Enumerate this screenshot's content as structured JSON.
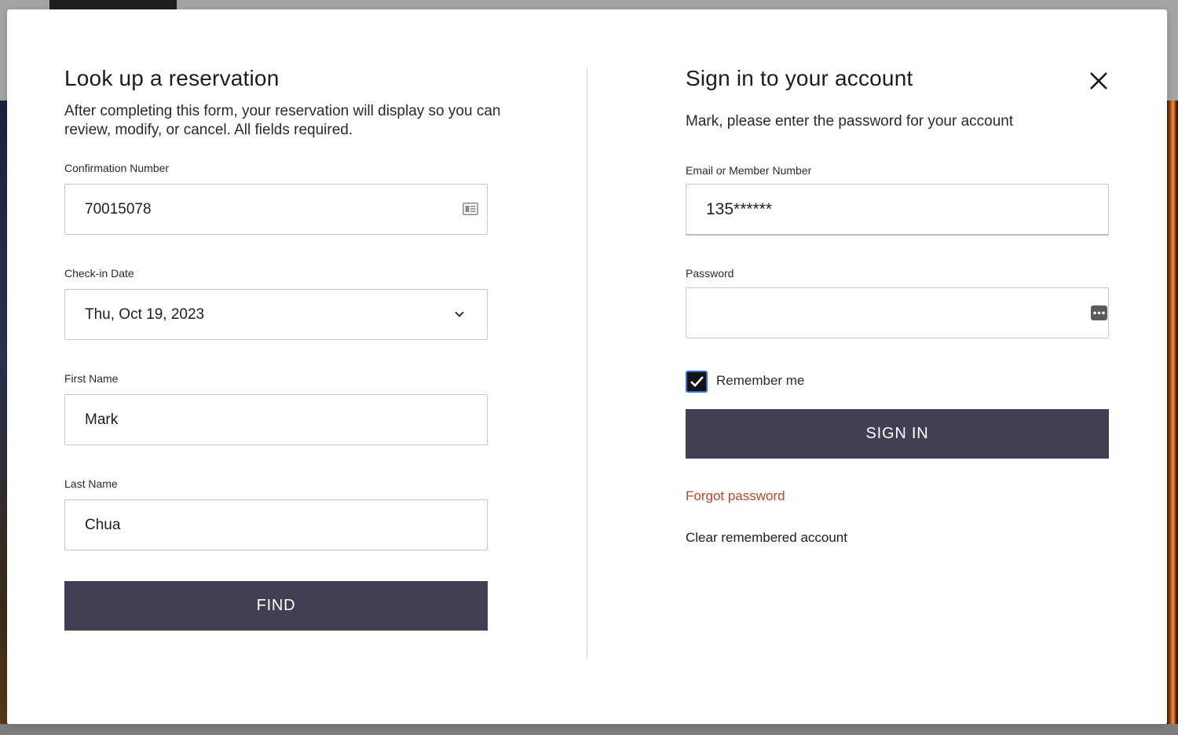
{
  "lookup": {
    "title": "Look up a reservation",
    "intro": "After completing this form, your reservation will display so you can review, modify, or cancel. All fields required.",
    "confirmation": {
      "label": "Confirmation Number",
      "value": "70015078"
    },
    "checkin": {
      "label": "Check-in Date",
      "value": "Thu, Oct 19, 2023"
    },
    "first_name": {
      "label": "First Name",
      "value": "Mark"
    },
    "last_name": {
      "label": "Last Name",
      "value": "Chua"
    },
    "find_label": "FIND"
  },
  "signin": {
    "title": "Sign in to your account",
    "intro": "Mark, please enter the password for your account",
    "email": {
      "label": "Email or Member Number",
      "value": "135******"
    },
    "password": {
      "label": "Password",
      "value": ""
    },
    "remember_label": "Remember me",
    "remember_checked": true,
    "signin_label": "SIGN IN",
    "forgot_label": "Forgot password",
    "clear_label": "Clear remembered account"
  },
  "icons": {
    "confirmation": "id-card-icon",
    "checkin": "chevron-down-icon",
    "password": "password-manager-icon",
    "close": "close-icon",
    "checkbox": "checkmark-icon"
  },
  "colors": {
    "button_bg": "#433f53",
    "link_forgot": "#b2472a",
    "checkbox_border": "#2f6fd6"
  }
}
